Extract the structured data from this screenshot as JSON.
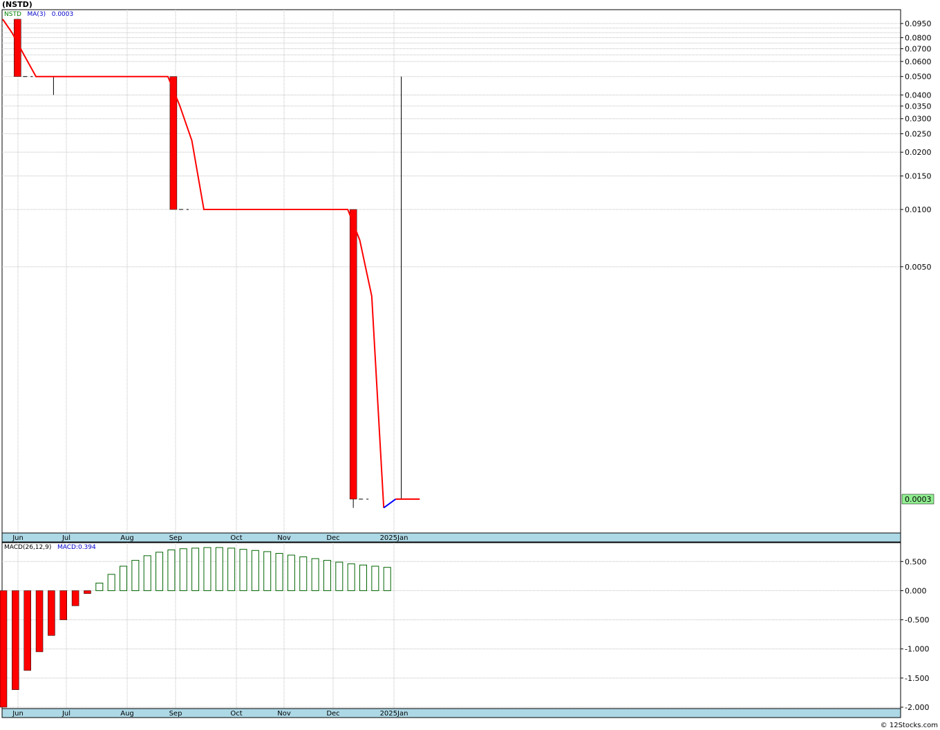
{
  "title": "(NSTD)",
  "legend": {
    "symbol": "NSTD",
    "ma_label": "MA(3)",
    "last_value": "0.0003",
    "macd_label": "MACD(26,12,9)",
    "macd_value": "MACD:0.394"
  },
  "credit": "© 12Stocks.com",
  "colors": {
    "symbol": "#008000",
    "ma_label": "#0000cc",
    "bar_down": "#ff0000",
    "ma_line": "#ff0000",
    "ma_line_start": "#0000ff",
    "macd_pos": "#006400",
    "month_strip": "#add8e6",
    "last_price_box": "#90ee90",
    "grid": "#bfbfbf"
  },
  "chart_data": [
    {
      "type": "bar",
      "name": "price",
      "y_scale": "log",
      "y_ticks": [
        "0.0950",
        "0.0800",
        "0.0700",
        "0.0600",
        "0.0500",
        "0.0400",
        "0.0350",
        "0.0300",
        "0.0250",
        "0.0200",
        "0.0150",
        "0.0100",
        "0.0050"
      ],
      "last_price_label": "0.0003",
      "x_months": [
        "Jun",
        "Jul",
        "Aug",
        "Sep",
        "Oct",
        "Nov",
        "Dec",
        "2025Jan"
      ],
      "bars": [
        {
          "week": 1,
          "open": 0.1,
          "close": 0.05,
          "high": 0.1,
          "low": 0.05
        },
        {
          "week": 4,
          "open": 0.05,
          "close": 0.05,
          "high": 0.05,
          "low": 0.04
        },
        {
          "week": 14,
          "open": 0.05,
          "close": 0.01,
          "high": 0.05,
          "low": 0.01
        },
        {
          "week": 29,
          "open": 0.01,
          "close": 0.0003,
          "high": 0.01,
          "low": 0.00027
        },
        {
          "week": 33,
          "open": 0.0003,
          "close": 0.0003,
          "high": 0.05,
          "low": 0.0003
        }
      ],
      "ma": {
        "label": "MA(3)",
        "values": [
          0.1,
          0.085,
          0.065,
          0.05,
          0.05,
          0.05,
          0.05,
          0.05,
          0.05,
          0.05,
          0.05,
          0.05,
          0.05,
          0.05,
          0.05,
          0.035,
          0.023,
          0.01,
          0.01,
          0.01,
          0.01,
          0.01,
          0.01,
          0.01,
          0.01,
          0.01,
          0.01,
          0.01,
          0.01,
          0.01,
          0.0069,
          0.0035,
          0.00027,
          0.0003,
          0.0003,
          0.0003
        ]
      }
    },
    {
      "type": "bar",
      "name": "MACD(26,12,9)",
      "y_ticks": [
        "0.500",
        "0.000",
        "-0.500",
        "-1.000",
        "-1.500",
        "-2.000"
      ],
      "ylim": [
        -2.0,
        0.8
      ],
      "x_months": [
        "Jun",
        "Jul",
        "Aug",
        "Sep",
        "Oct",
        "Nov",
        "Dec",
        "2025Jan"
      ],
      "values": [
        -2.0,
        -1.7,
        -1.37,
        -1.05,
        -0.77,
        -0.5,
        -0.26,
        -0.05,
        0.13,
        0.28,
        0.42,
        0.52,
        0.6,
        0.66,
        0.7,
        0.72,
        0.73,
        0.74,
        0.74,
        0.73,
        0.71,
        0.69,
        0.67,
        0.64,
        0.61,
        0.58,
        0.55,
        0.52,
        0.49,
        0.46,
        0.44,
        0.42,
        0.4
      ]
    }
  ]
}
